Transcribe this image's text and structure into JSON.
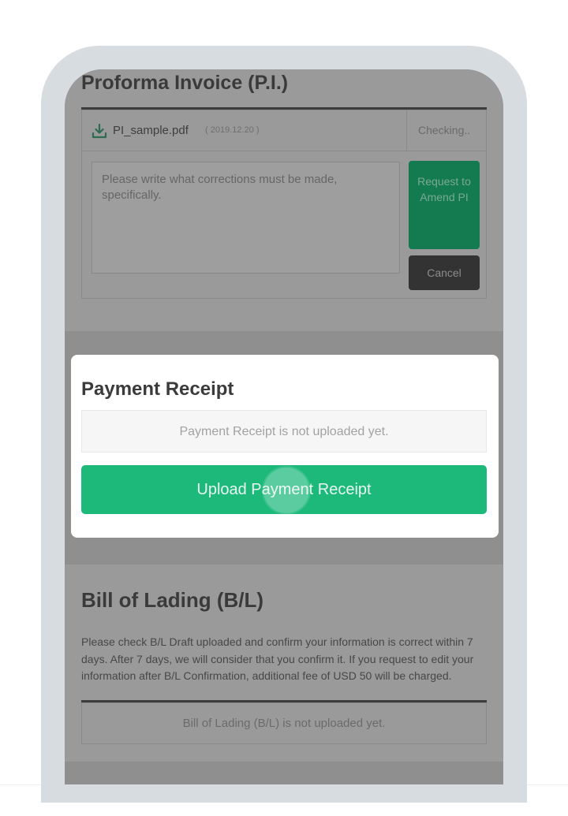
{
  "proforma_invoice": {
    "title": "Proforma Invoice (P.I.)",
    "file": {
      "name": "PI_sample.pdf",
      "date": "( 2019.12.20 )",
      "status": "Checking..",
      "icon": "download-icon"
    },
    "correction_placeholder": "Please write what corrections must be made, specifically.",
    "request_button_label": "Request to Amend PI",
    "cancel_button_label": "Cancel"
  },
  "payment_receipt": {
    "title": "Payment Receipt",
    "status_text": "Payment Receipt is not uploaded yet.",
    "upload_button_label": "Upload Payment Receipt"
  },
  "bill_of_lading": {
    "title": "Bill of Lading (B/L)",
    "description": "Please check B/L Draft uploaded and confirm your information is correct within 7 days. After 7 days, we will consider that you confirm it. If you request to edit your information after B/L Confirmation, additional fee of USD 50 will be charged.",
    "status_text": "Bill of Lading (B/L) is not uploaded yet."
  },
  "colors": {
    "accent_green": "#1db97b",
    "overlay_dim": "#8f8f8f",
    "frame": "#d7dce0"
  }
}
